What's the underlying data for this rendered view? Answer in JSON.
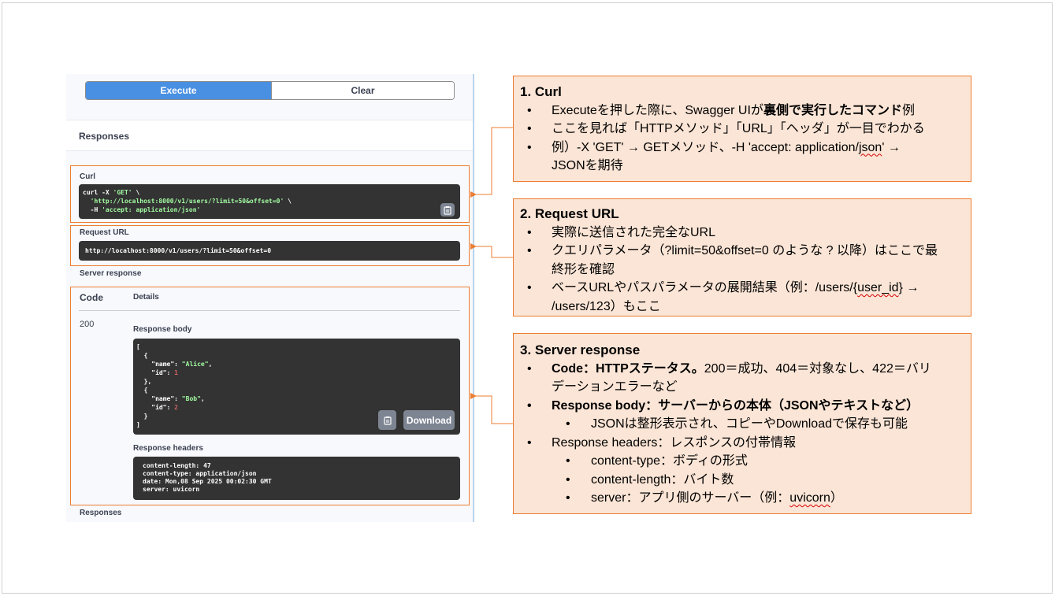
{
  "swagger": {
    "execute_label": "Execute",
    "clear_label": "Clear",
    "responses_heading": "Responses",
    "curl_label": "Curl",
    "curl_lines": {
      "l1_plain": "curl -X ",
      "l1_str": "'GET'",
      "l1_tail": " \\",
      "l2_str": "'http://localhost:8000/v1/users/?limit=50&offset=0'",
      "l2_tail": " \\",
      "l3_plain": "-H ",
      "l3_str": "'accept: application/json'"
    },
    "request_url_label": "Request URL",
    "request_url": "http://localhost:8000/v1/users/?limit=50&offset=0",
    "server_response_label": "Server response",
    "code_header": "Code",
    "details_header": "Details",
    "status_code": "200",
    "response_body_label": "Response body",
    "response_body": [
      {
        "name": "Alice",
        "id": "1"
      },
      {
        "name": "Bob",
        "id": "2"
      }
    ],
    "download_label": "Download",
    "response_headers_label": "Response headers",
    "response_headers": [
      "content-length: 47",
      "content-type: application/json",
      "date: Mon,08 Sep 2025 00:02:30 GMT",
      "server: uvicorn"
    ],
    "footer_responses": "Responses"
  },
  "callouts": {
    "curl": {
      "title": "1. Curl",
      "b1_pre": "Executeを押した際に、Swagger UIが",
      "b1_bold": "裏側で実行したコマンド",
      "b1_post": "例",
      "b2": "ここを見れば「HTTPメソッド」「URL」「ヘッダ」が一目でわかる",
      "b3_pre": "例）-X 'GET' → GETメソッド、-H 'accept: application/",
      "b3_squig": "json",
      "b3_post": "' →",
      "b3_cont": "JSONを期待"
    },
    "request_url": {
      "title": "2. Request URL",
      "b1": "実際に送信された完全なURL",
      "b2_l1": "クエリパラメータ（?limit=50&offset=0 のような ? 以降）はここで最",
      "b2_l2": "終形を確認",
      "b3_pre": "ベースURLやパスパラメータの展開結果（例：/users/{",
      "b3_squig": "user_id",
      "b3_post": "} →",
      "b3_cont": "/users/123）もここ"
    },
    "server_response": {
      "title": "3. Server response",
      "b1_bold": "Code：HTTPステータス。",
      "b1_rest": "200＝成功、404＝対象なし、422＝バリ",
      "b1_cont": "デーションエラーなど",
      "b2_bold": "Response body：サーバーからの本体（JSONやテキストなど）",
      "b2_sub": "JSONは整形表示され、コピーやDownloadで保存も可能",
      "b3": "Response headers：レスポンスの付帯情報",
      "b3_sub1": "content-type：ボディの形式",
      "b3_sub2": "content-length：バイト数",
      "b3_sub3_pre": "server：アプリ側のサーバー（例：",
      "b3_sub3_squig": "uvicorn",
      "b3_sub3_post": "）"
    }
  },
  "colors": {
    "accent_orange": "#ed7d31",
    "callout_fill": "#fbe5d6",
    "execute_blue": "#4990e2",
    "code_bg": "#333333"
  }
}
